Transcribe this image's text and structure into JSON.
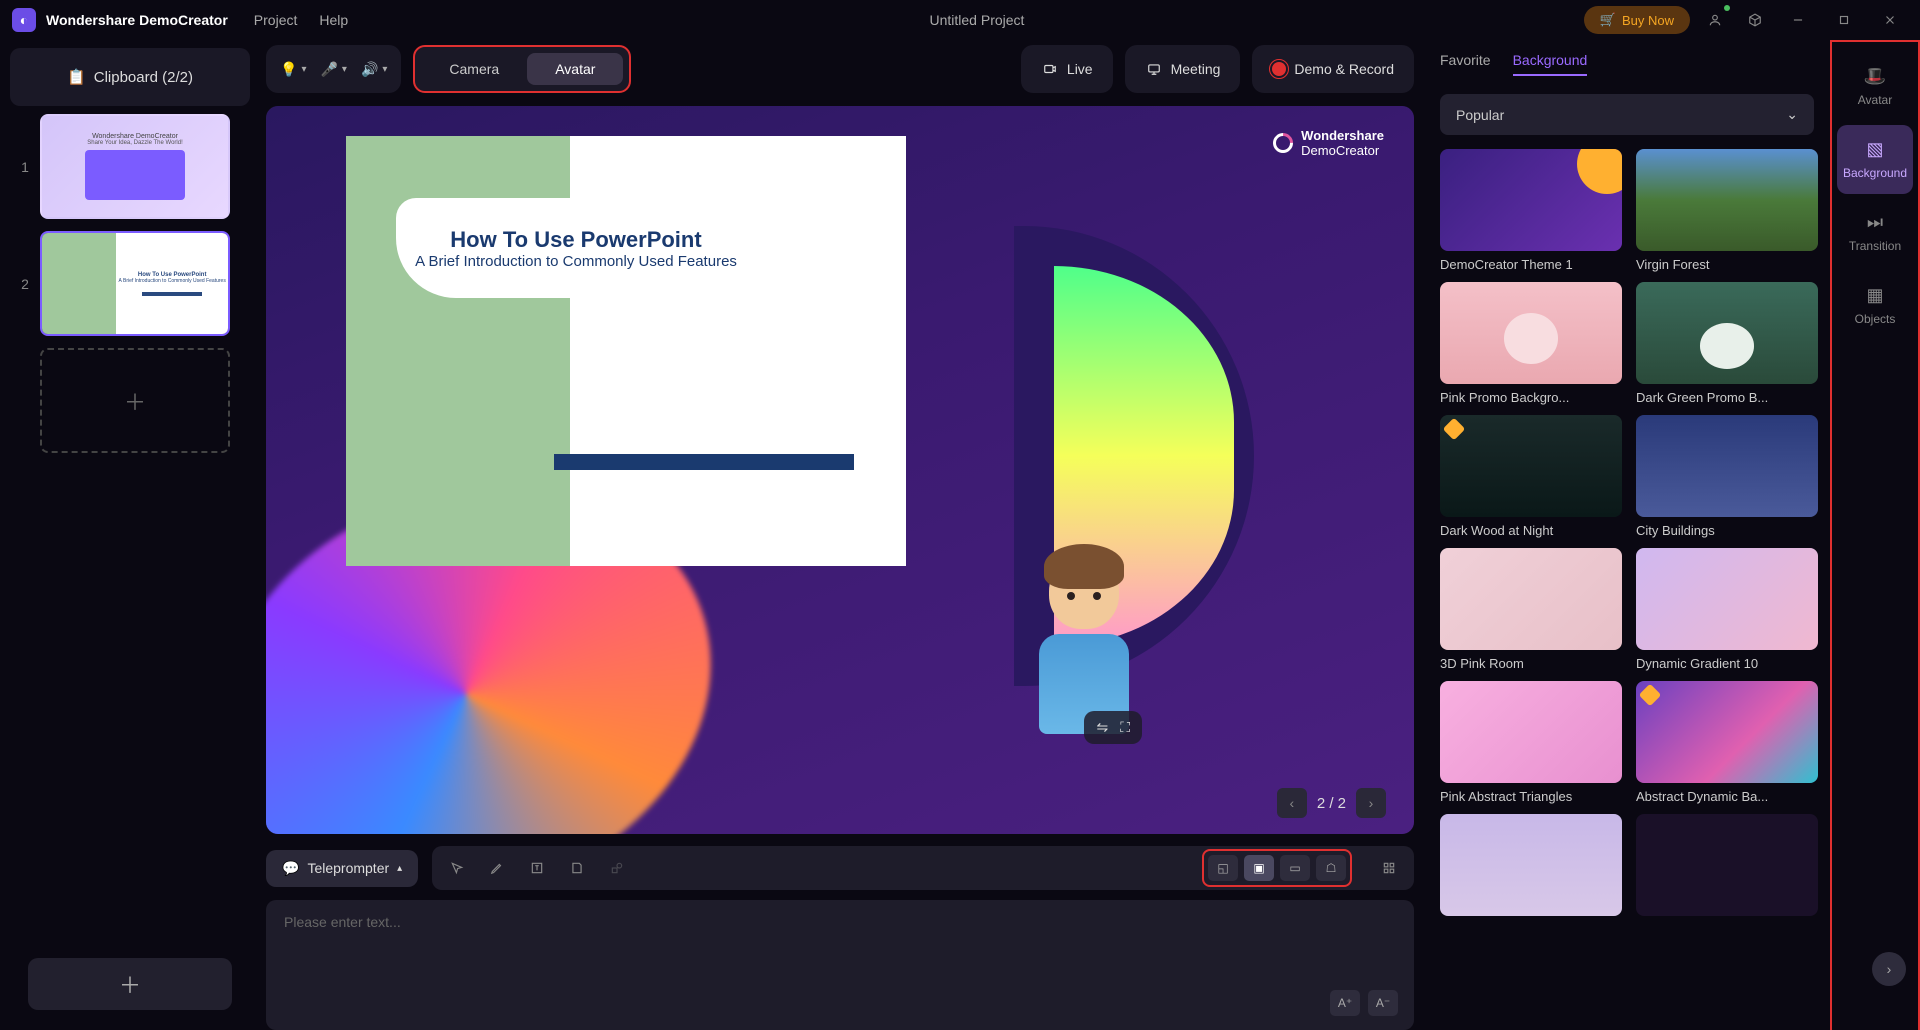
{
  "titlebar": {
    "brand": "Wondershare DemoCreator",
    "menu": {
      "project": "Project",
      "help": "Help"
    },
    "title": "Untitled Project",
    "buy": "Buy Now"
  },
  "left": {
    "clipboard": "Clipboard (2/2)",
    "slides": [
      {
        "num": "1",
        "headline": "Share Your Idea, Dazzle The World!"
      },
      {
        "num": "2",
        "title": "How To Use PowerPoint",
        "sub": "A Brief Introduction to Commonly Used Features"
      }
    ]
  },
  "modes": {
    "camera": "Camera",
    "avatar": "Avatar"
  },
  "actions": {
    "live": "Live",
    "meeting": "Meeting",
    "demo": "Demo & Record"
  },
  "stage": {
    "watermark_l1": "Wondershare",
    "watermark_l2": "DemoCreator",
    "ppt_title": "How To Use PowerPoint",
    "ppt_sub": "A Brief Introduction to Commonly Used Features",
    "pager": "2 / 2"
  },
  "tele": {
    "label": "Teleprompter",
    "placeholder": "Please enter text...",
    "font_up": "A⁺",
    "font_dn": "A⁻"
  },
  "rp": {
    "tabs": {
      "favorite": "Favorite",
      "background": "Background"
    },
    "filter": "Popular",
    "items": [
      {
        "label": "DemoCreator Theme 1",
        "cls": "bt-demo"
      },
      {
        "label": "Virgin Forest",
        "cls": "bt-forest"
      },
      {
        "label": "Pink Promo Backgro...",
        "cls": "bt-pink"
      },
      {
        "label": "Dark Green Promo B...",
        "cls": "bt-darkgreen"
      },
      {
        "label": "Dark Wood at Night",
        "cls": "bt-wood",
        "badge": true
      },
      {
        "label": "City Buildings",
        "cls": "bt-city"
      },
      {
        "label": "3D Pink Room",
        "cls": "bt-room"
      },
      {
        "label": "Dynamic Gradient 10",
        "cls": "bt-grad10"
      },
      {
        "label": "Pink Abstract Triangles",
        "cls": "bt-pinktri"
      },
      {
        "label": "Abstract Dynamic Ba...",
        "cls": "bt-absdyn",
        "badge": true
      },
      {
        "label": "",
        "cls": "bt-part1"
      },
      {
        "label": "",
        "cls": "bt-part2"
      }
    ]
  },
  "rail": {
    "avatar": "Avatar",
    "background": "Background",
    "transition": "Transition",
    "objects": "Objects"
  }
}
